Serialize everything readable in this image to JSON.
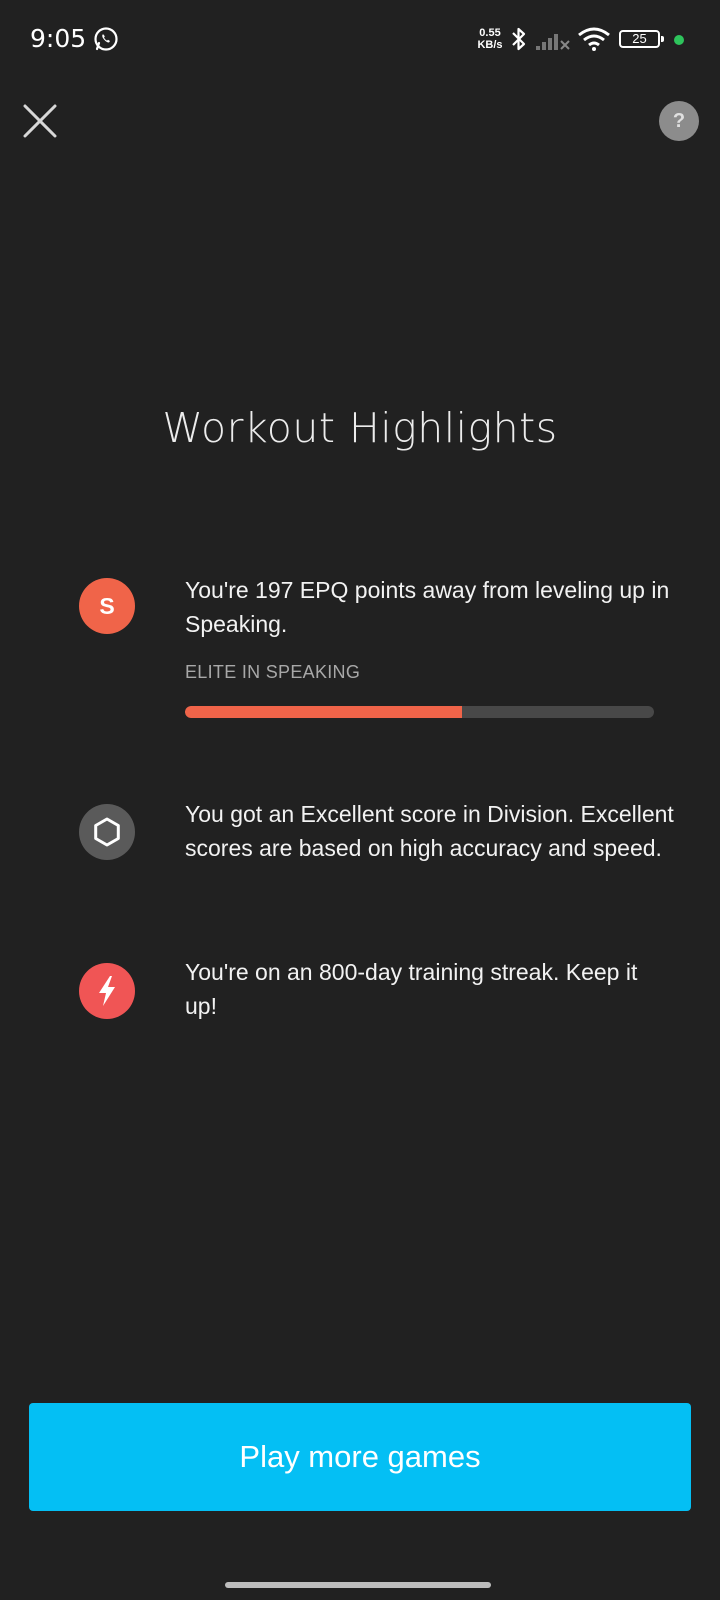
{
  "status_bar": {
    "time": "9:05",
    "net_speed_value": "0.55",
    "net_speed_unit": "KB/s",
    "battery": "25",
    "icons": [
      "whatsapp-icon",
      "bluetooth-icon",
      "signal-icon",
      "wifi-icon",
      "battery-icon",
      "green-dot-icon"
    ]
  },
  "header": {
    "close_icon": "close-icon",
    "help_label": "?"
  },
  "title": "Workout Highlights",
  "highlights": [
    {
      "icon": "speaking-s-icon",
      "icon_letter": "S",
      "icon_color": "#f06449",
      "text": "You're 197 EPQ points away from leveling up in Speaking.",
      "level_label": "ELITE IN SPEAKING",
      "progress_fraction": 0.59
    },
    {
      "icon": "hexagon-icon",
      "icon_color": "#5a5a5a",
      "text": "You got an Excellent score in Division. Excellent scores are based on high accuracy and speed."
    },
    {
      "icon": "lightning-bolt-icon",
      "icon_color": "#f05555",
      "text": "You're on an 800-day training streak. Keep it up!"
    }
  ],
  "cta": {
    "label": "Play more games",
    "color": "#04bff4"
  }
}
